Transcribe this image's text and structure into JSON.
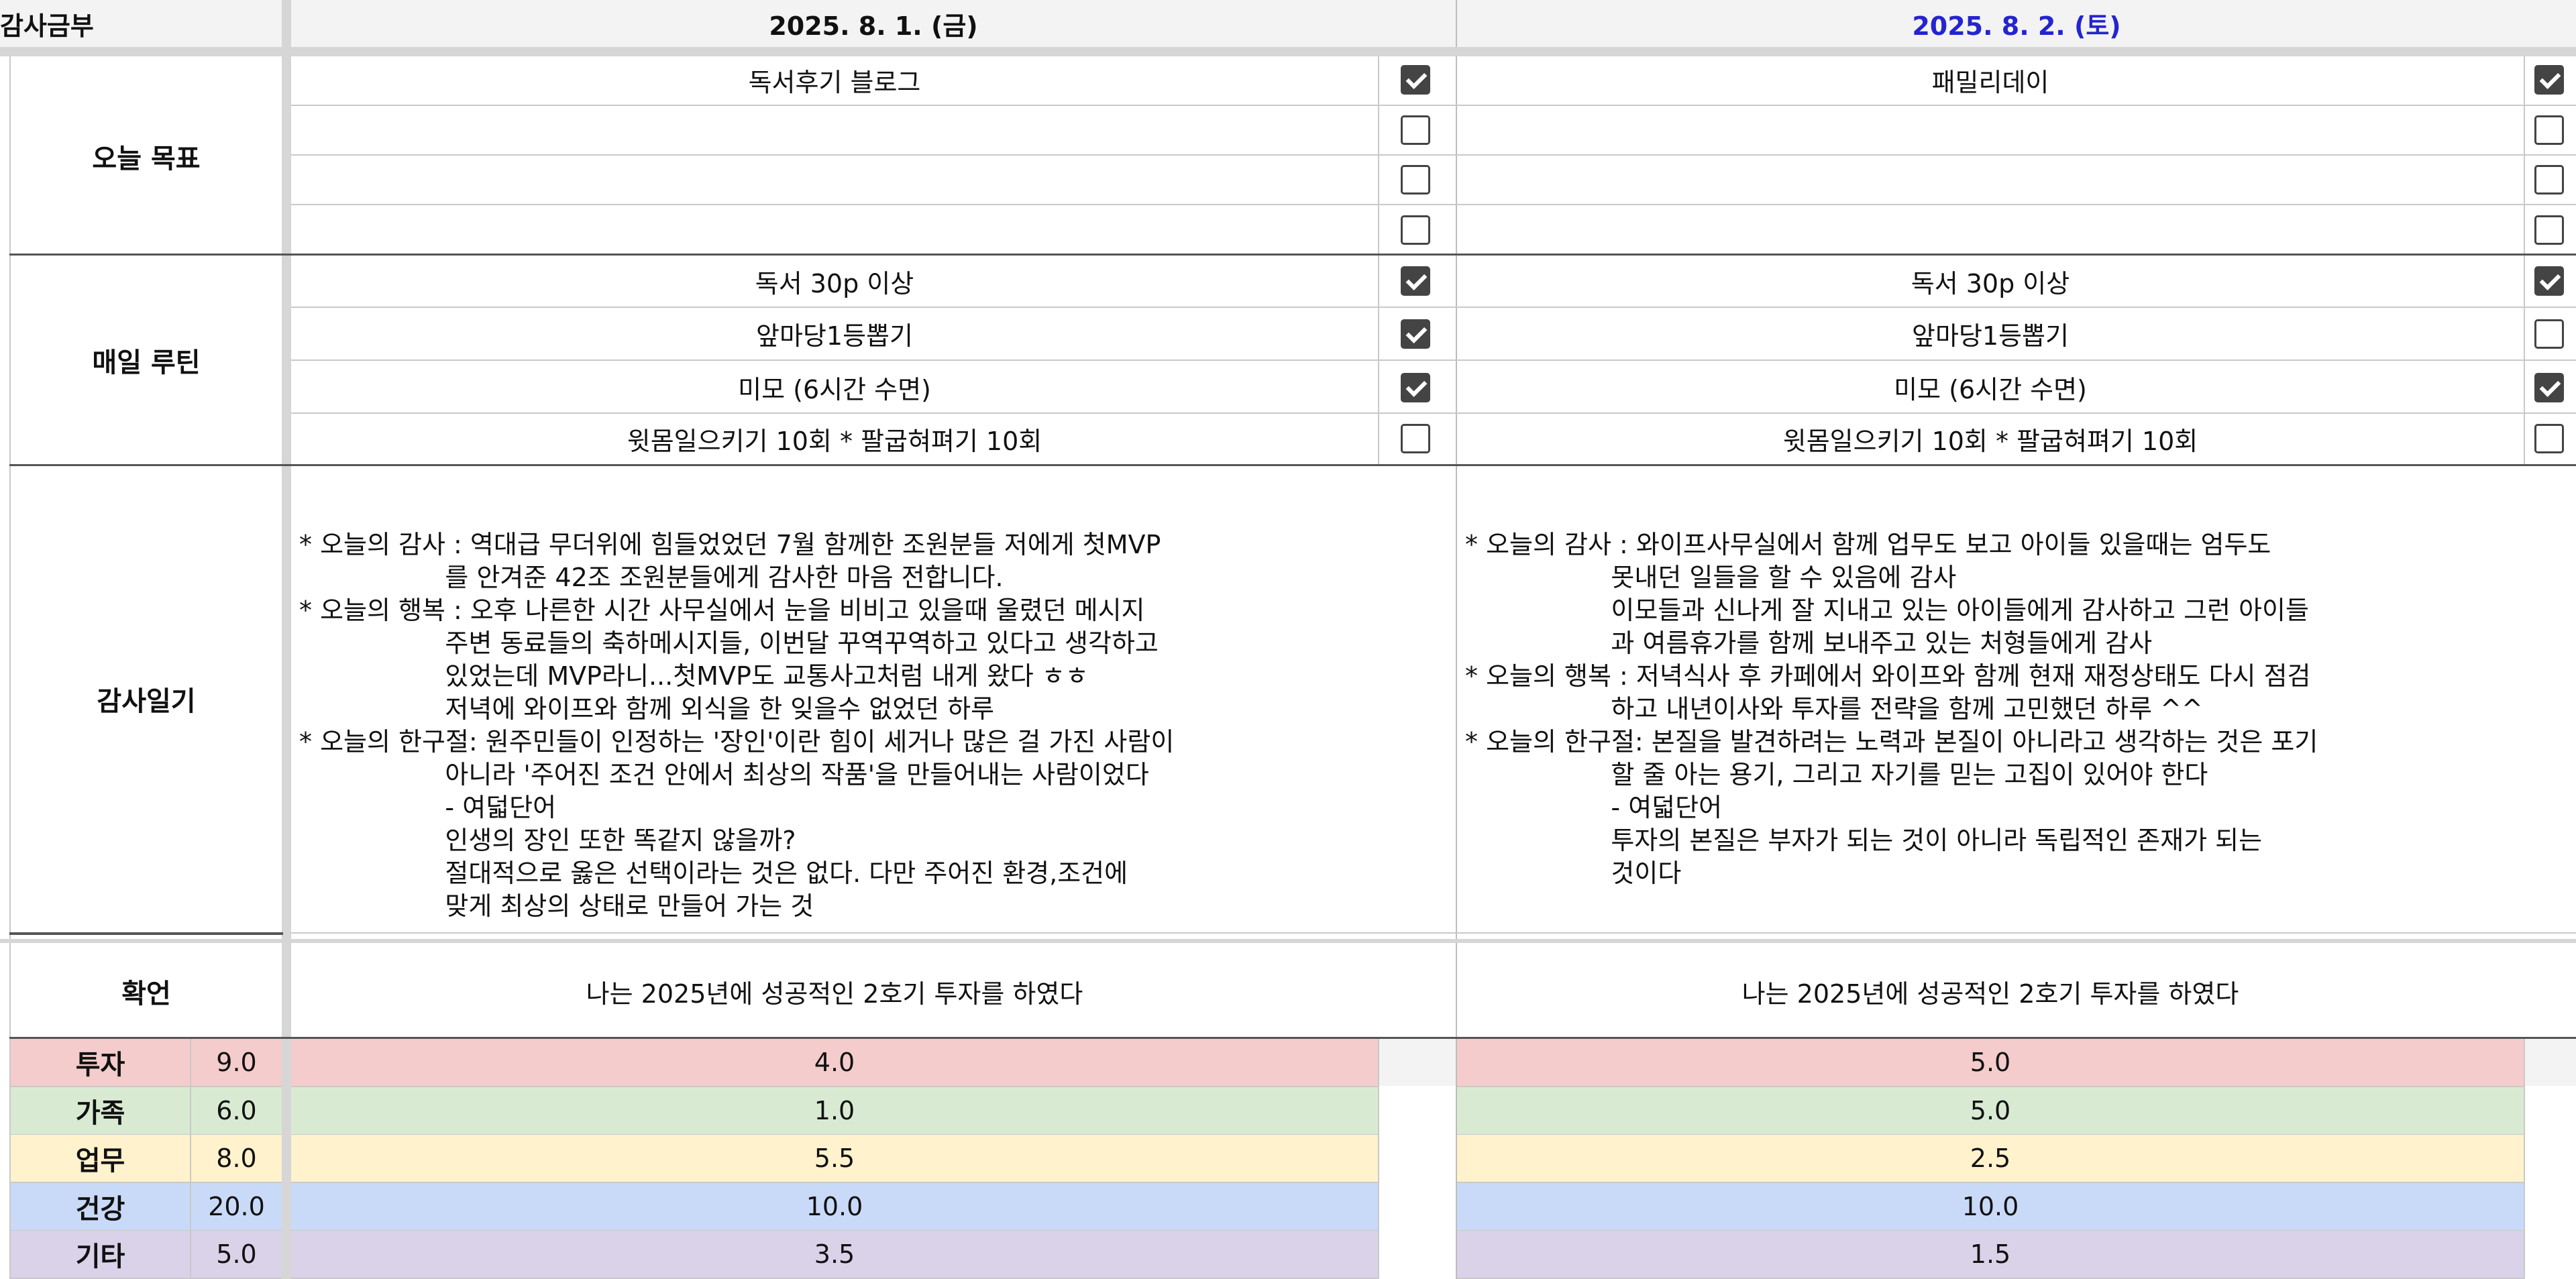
{
  "header": {
    "corner_label": "감사금부",
    "day1_date": "2025. 8. 1. (금)",
    "day2_date": "2025. 8. 2. (토)"
  },
  "colors": {
    "saturday_text": "#2424d0",
    "investment": "#f4cccc",
    "family": "#d9ead3",
    "work": "#fff2cc",
    "health": "#c9daf8",
    "other": "#d9d2e9"
  },
  "sections": {
    "goals": "오늘 목표",
    "routine": "매일 루틴",
    "diary": "감사일기",
    "affirmation": "확언"
  },
  "goals": {
    "day1": [
      {
        "text": "독서후기 블로그",
        "checked": true
      },
      {
        "text": "",
        "checked": false
      },
      {
        "text": "",
        "checked": false
      },
      {
        "text": "",
        "checked": false
      }
    ],
    "day2": [
      {
        "text": "패밀리데이",
        "checked": true
      },
      {
        "text": "",
        "checked": false
      },
      {
        "text": "",
        "checked": false
      },
      {
        "text": "",
        "checked": false
      }
    ]
  },
  "routine": {
    "day1": [
      {
        "text": "독서 30p 이상",
        "checked": true
      },
      {
        "text": "앞마당1등뽑기",
        "checked": true
      },
      {
        "text": "미모 (6시간 수면)",
        "checked": true
      },
      {
        "text": "윗몸일으키기 10회 * 팔굽혀펴기 10회",
        "checked": false
      }
    ],
    "day2": [
      {
        "text": "독서 30p 이상",
        "checked": true
      },
      {
        "text": "앞마당1등뽑기",
        "checked": false
      },
      {
        "text": "미모 (6시간 수면)",
        "checked": true
      },
      {
        "text": "윗몸일으키기 10회 * 팔굽혀펴기 10회",
        "checked": false
      }
    ]
  },
  "diary": {
    "day1": "* 오늘의 감사 : 역대급 무더위에 힘들었었던 7월 함께한 조원분들 저에게 첫MVP\n                  를 안겨준 42조 조원분들에게 감사한 마음 전합니다.\n* 오늘의 행복 : 오후 나른한 시간 사무실에서 눈을 비비고 있을때 울렸던 메시지\n                  주변 동료들의 축하메시지들, 이번달 꾸역꾸역하고 있다고 생각하고\n                  있었는데 MVP라니...첫MVP도 교통사고처럼 내게 왔다 ㅎㅎ\n                  저녁에 와이프와 함께 외식을 한 잊을수 없었던 하루\n* 오늘의 한구절: 원주민들이 인정하는 '장인'이란 힘이 세거나 많은 걸 가진 사람이\n                  아니라 '주어진 조건 안에서 최상의 작품'을 만들어내는 사람이었다\n                  - 여덟단어\n                  인생의 장인 또한 똑같지 않을까?\n                  절대적으로 옳은 선택이라는 것은 없다. 다만 주어진 환경,조건에\n                  맞게 최상의 상태로 만들어 가는 것",
    "day2": "* 오늘의 감사 : 와이프사무실에서 함께 업무도 보고 아이들 있을때는 엄두도\n                  못내던 일들을 할 수 있음에 감사\n                  이모들과 신나게 잘 지내고 있는 아이들에게 감사하고 그런 아이들\n                  과 여름휴가를 함께 보내주고 있는 처형들에게 감사\n* 오늘의 행복 : 저녁식사 후 카페에서 와이프와 함께 현재 재정상태도 다시 점검\n                  하고 내년이사와 투자를 전략을 함께 고민했던 하루 ^^\n* 오늘의 한구절: 본질을 발견하려는 노력과 본질이 아니라고 생각하는 것은 포기\n                  할 줄 아는 용기, 그리고 자기를 믿는 고집이 있어야 한다\n                  - 여덟단어\n                  투자의 본질은 부자가 되는 것이 아니라 독립적인 존재가 되는\n                  것이다"
  },
  "affirmation": {
    "day1": "나는 2025년에 성공적인 2호기 투자를 하였다",
    "day2": "나는 2025년에 성공적인 2호기 투자를 하였다"
  },
  "scores": [
    {
      "label": "투자",
      "target": "9.0",
      "day1": "4.0",
      "day2": "5.0",
      "color": "#f4cccc"
    },
    {
      "label": "가족",
      "target": "6.0",
      "day1": "1.0",
      "day2": "5.0",
      "color": "#d9ead3"
    },
    {
      "label": "업무",
      "target": "8.0",
      "day1": "5.5",
      "day2": "2.5",
      "color": "#fff2cc"
    },
    {
      "label": "건강",
      "target": "20.0",
      "day1": "10.0",
      "day2": "10.0",
      "color": "#c9daf8"
    },
    {
      "label": "기타",
      "target": "5.0",
      "day1": "3.5",
      "day2": "1.5",
      "color": "#d9d2e9"
    }
  ]
}
